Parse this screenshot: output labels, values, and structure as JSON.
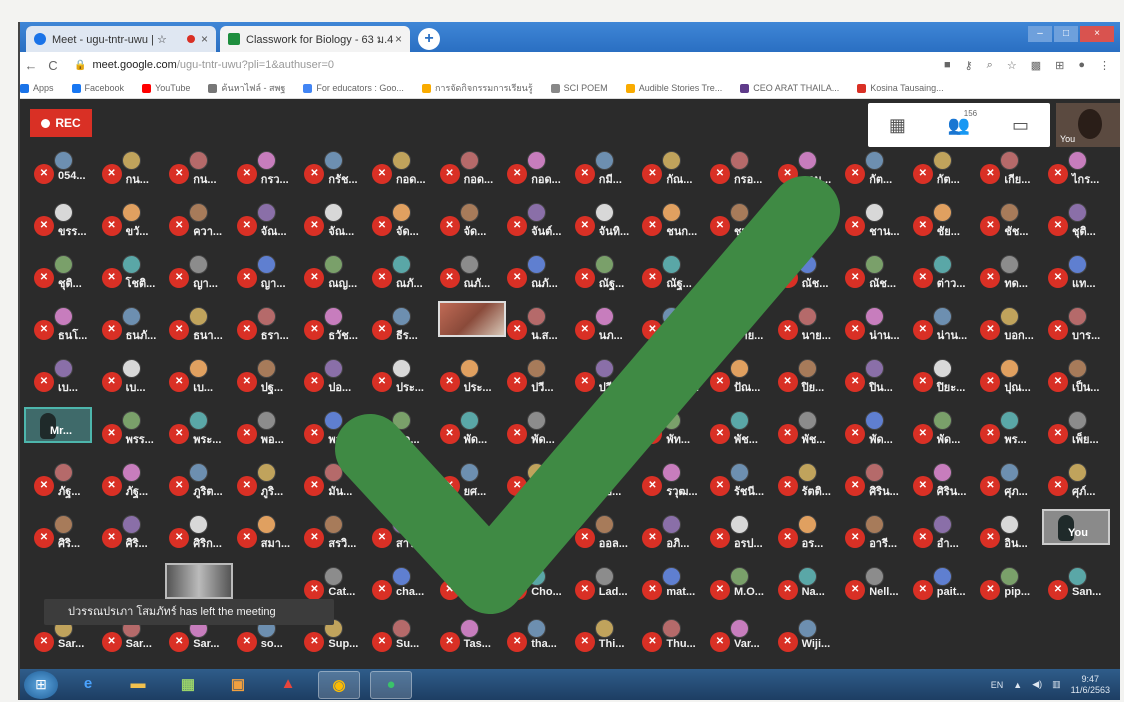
{
  "browser": {
    "tabs": [
      {
        "title": "Meet - ugu-tntr-uwu | ☆",
        "active": true,
        "recording": true,
        "close": "×"
      },
      {
        "title": "Classwork for Biology - 63 ม.4",
        "active": false,
        "close": "×"
      }
    ],
    "new_tab": "+",
    "window_controls": {
      "minimize": "–",
      "maximize": "□",
      "close": "×"
    },
    "back": "←",
    "reload": "C",
    "url_host": "meet.google.com",
    "url_path": "/ugu-tntr-uwu?pli=1&authuser=0",
    "bookmarks": [
      {
        "label": "Apps",
        "color": "#1a73e8"
      },
      {
        "label": "Facebook",
        "color": "#1877f2"
      },
      {
        "label": "YouTube",
        "color": "#ff0000"
      },
      {
        "label": "ค้นหาไฟล์ - สพฐ",
        "color": "#777777"
      },
      {
        "label": "For educators : Goo...",
        "color": "#4285f4"
      },
      {
        "label": "การจัดกิจกรรมการเรียนรู้",
        "color": "#f9ab00"
      },
      {
        "label": "SCI POEM",
        "color": "#888888"
      },
      {
        "label": "Audible Stories Tre...",
        "color": "#f9ab00"
      },
      {
        "label": "CEO ARAT THAILA...",
        "color": "#5f3b8a"
      },
      {
        "label": "Kosina Tausaing...",
        "color": "#d93025"
      }
    ]
  },
  "meet": {
    "rec_label": "REC",
    "participant_count": "156",
    "self_label": "You",
    "toast": "ปวรรณปรเภา โสมภัทร์ has left the meeting",
    "participants": [
      [
        "054...",
        "กน...",
        "กน...",
        "กรว...",
        "กรัช...",
        "กอด...",
        "กอด...",
        "กอด...",
        "กมี...",
        "กัณ...",
        "กรอ...",
        "กาน...",
        "กัต...",
        "กัต...",
        "เกีย...",
        "ไกร..."
      ],
      [
        "ขรร...",
        "ขวั...",
        "ควา...",
        "จัณ...",
        "จัณ...",
        "จัด...",
        "จัด...",
        "จันต์...",
        "จันทิ...",
        "ชนก...",
        "ชนา...",
        "ชลา...",
        "ชาน...",
        "ชัย...",
        "ชัช...",
        "ชุติ..."
      ],
      [
        "ชุติ...",
        "โชติ...",
        "ญา...",
        "ญา...",
        "ณญ...",
        "ณภั...",
        "ณภั...",
        "ณภั...",
        "ณัฐ...",
        "ณัฐ...",
        "ณัช...",
        "ณัช...",
        "ณัช...",
        "ต่าว...",
        "ทด...",
        "แท..."
      ],
      [
        "ธนโ...",
        "ธนภั...",
        "ธนา...",
        "ธรา...",
        "ธวัช...",
        "ธีร...",
        "",
        "น.ส...",
        "นภ...",
        "นาย...",
        "นาย...",
        "นาย...",
        "น่าน...",
        "น่าน...",
        "บอก...",
        "บาร..."
      ],
      [
        "เบ...",
        "เบ...",
        "เบ...",
        "ปฐ...",
        "ปอ...",
        "ประ...",
        "ประ...",
        "ปวี...",
        "ปวีณ...",
        "ปวีณ...",
        "ปัณ...",
        "ปิย...",
        "ปิน...",
        "ปิยะ...",
        "ปุณ...",
        "เป็น..."
      ],
      [
        "",
        "พรร...",
        "พระ...",
        "พอ...",
        "พอ...",
        "พัด...",
        "พัด...",
        "พัด...",
        "พัท...",
        "พัท...",
        "พัช...",
        "พัช...",
        "พัด...",
        "พัด...",
        "พร...",
        "เพ็ย..."
      ],
      [
        "ภัฐ...",
        "ภัฐ...",
        "ภูริต...",
        "ภูริ...",
        "มัน...",
        "มิ่ง...",
        "ยศ...",
        "ยุพ...",
        "รชิ...",
        "รวุฒ...",
        "รัชนี...",
        "รัตติ...",
        "ศิริน...",
        "ศิริน...",
        "ศุภ...",
        "ศุภ์..."
      ],
      [
        "ศิริ...",
        "ศิริ...",
        "ศิริก...",
        "สมา...",
        "สรวิ...",
        "สาร...",
        "สิริ...",
        "สหร...",
        "ออล...",
        "อภิ...",
        "อรป...",
        "อร...",
        "อารี...",
        "อำ...",
        "อิน...",
        "You"
      ],
      [
        "",
        "",
        "",
        "",
        "Cat...",
        "cha...",
        "Cha...",
        "Cho...",
        "Lad...",
        "mat...",
        "M.O...",
        "Na...",
        "Nell...",
        "pait...",
        "pip...",
        "San..."
      ],
      [
        "Sar...",
        "Sar...",
        "Sar...",
        "so...",
        "Sup...",
        "Su...",
        "Tas...",
        "tha...",
        "Thi...",
        "Thu...",
        "Var...",
        "Wiji..."
      ]
    ],
    "video_tiles": [
      {
        "label": "Mr...",
        "kind": "lecturer"
      },
      {
        "label": "",
        "kind": "room"
      },
      {
        "label": "",
        "kind": "presenting"
      },
      {
        "label": "You",
        "kind": "self"
      }
    ],
    "colors": {
      "mic_off": "#d93025",
      "check": "#3f8a44",
      "rec": "#d93025"
    }
  },
  "taskbar": {
    "apps": [
      {
        "name": "internet-explorer",
        "glyph": "e",
        "color": "#4aa3ff"
      },
      {
        "name": "file-explorer",
        "glyph": "▬",
        "color": "#f2c14e"
      },
      {
        "name": "media-center",
        "glyph": "▦",
        "color": "#9ad36a"
      },
      {
        "name": "presentation-app",
        "glyph": "▣",
        "color": "#f0a040"
      },
      {
        "name": "pdf-reader",
        "glyph": "▲",
        "color": "#e8453c"
      },
      {
        "name": "chrome",
        "glyph": "◉",
        "color": "#fbbc05"
      },
      {
        "name": "line-app",
        "glyph": "●",
        "color": "#3ac26a"
      }
    ],
    "lang": "EN",
    "time": "9:47",
    "date": "11/6/2563"
  }
}
